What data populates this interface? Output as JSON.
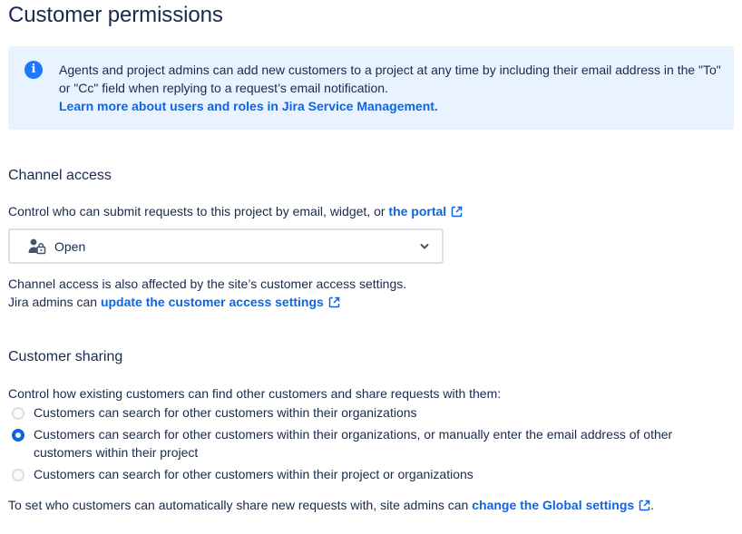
{
  "page": {
    "title": "Customer permissions"
  },
  "info": {
    "text": "Agents and project admins can add new customers to a project at any time by including their email address in the \"To\" or \"Cc\" field when replying to a request’s email notification.",
    "link": "Learn more about users and roles in Jira Service Management."
  },
  "channel_access": {
    "heading": "Channel access",
    "description": "Control who can submit requests to this project by email, widget, or ",
    "portal_link": "the portal",
    "select_value": "Open",
    "note_line1": "Channel access is also affected by the site’s customer access settings.",
    "note_line2_prefix": "Jira admins can ",
    "note_link": "update the customer access settings"
  },
  "customer_sharing": {
    "heading": "Customer sharing",
    "description": "Control how existing customers can find other customers and share requests with them:",
    "options": [
      {
        "label": "Customers can search for other customers within their organizations",
        "checked": false
      },
      {
        "label": "Customers can search for other customers within their organizations, or manually enter the email address of other customers within their project",
        "checked": true
      },
      {
        "label": "Customers can search for other customers within their project or organizations",
        "checked": false
      }
    ],
    "footer_prefix": "To set who customers can automatically share new requests with, site admins can ",
    "footer_link": "change the Global settings",
    "footer_suffix": "."
  },
  "icons": {
    "info": "info-icon",
    "select": "user-lock-icon",
    "chevron": "chevron-down-icon",
    "external": "external-link-icon"
  },
  "colors": {
    "info_bg": "#e9f2ff",
    "info_icon": "#1d7afc",
    "link": "#0c66e4",
    "text": "#172b4d"
  }
}
